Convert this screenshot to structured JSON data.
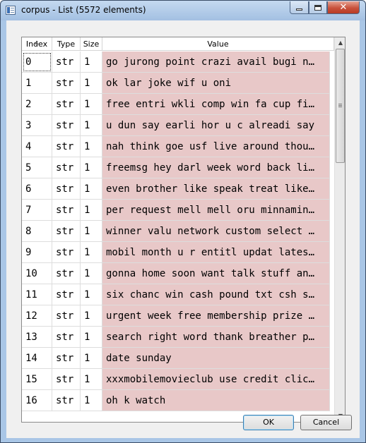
{
  "window": {
    "title": "corpus - List (5572 elements)",
    "controls": {
      "close_glyph": "✕"
    }
  },
  "table": {
    "columns": [
      "Index",
      "Type",
      "Size",
      "Value"
    ],
    "rows": [
      {
        "index": "0",
        "type": "str",
        "size": "1",
        "value": "go jurong point crazi avail bugi n…"
      },
      {
        "index": "1",
        "type": "str",
        "size": "1",
        "value": "ok lar joke wif u oni"
      },
      {
        "index": "2",
        "type": "str",
        "size": "1",
        "value": "free entri wkli comp win fa cup fi…"
      },
      {
        "index": "3",
        "type": "str",
        "size": "1",
        "value": "u dun say earli hor u c alreadi say"
      },
      {
        "index": "4",
        "type": "str",
        "size": "1",
        "value": "nah think goe usf live around thou…"
      },
      {
        "index": "5",
        "type": "str",
        "size": "1",
        "value": "freemsg hey darl week word back li…"
      },
      {
        "index": "6",
        "type": "str",
        "size": "1",
        "value": "even brother like speak treat like…"
      },
      {
        "index": "7",
        "type": "str",
        "size": "1",
        "value": "per request mell mell oru minnamin…"
      },
      {
        "index": "8",
        "type": "str",
        "size": "1",
        "value": "winner valu network custom select …"
      },
      {
        "index": "9",
        "type": "str",
        "size": "1",
        "value": "mobil month u r entitl updat lates…"
      },
      {
        "index": "10",
        "type": "str",
        "size": "1",
        "value": "gonna home soon want talk stuff an…"
      },
      {
        "index": "11",
        "type": "str",
        "size": "1",
        "value": "six chanc win cash pound txt csh s…"
      },
      {
        "index": "12",
        "type": "str",
        "size": "1",
        "value": "urgent week free membership prize …"
      },
      {
        "index": "13",
        "type": "str",
        "size": "1",
        "value": "search right word thank breather p…"
      },
      {
        "index": "14",
        "type": "str",
        "size": "1",
        "value": "date sunday"
      },
      {
        "index": "15",
        "type": "str",
        "size": "1",
        "value": "xxxmobilemovieclub use credit clic…"
      },
      {
        "index": "16",
        "type": "str",
        "size": "1",
        "value": "oh k watch"
      }
    ],
    "value_cell_color": "#e8c8c8",
    "selected_index": "0"
  },
  "buttons": {
    "ok": "OK",
    "cancel": "Cancel"
  },
  "icons": {
    "app": "list-window-icon",
    "sort": "sort-arrow-icon",
    "scroll_up": "scroll-up-icon",
    "scroll_down": "scroll-down-icon"
  }
}
